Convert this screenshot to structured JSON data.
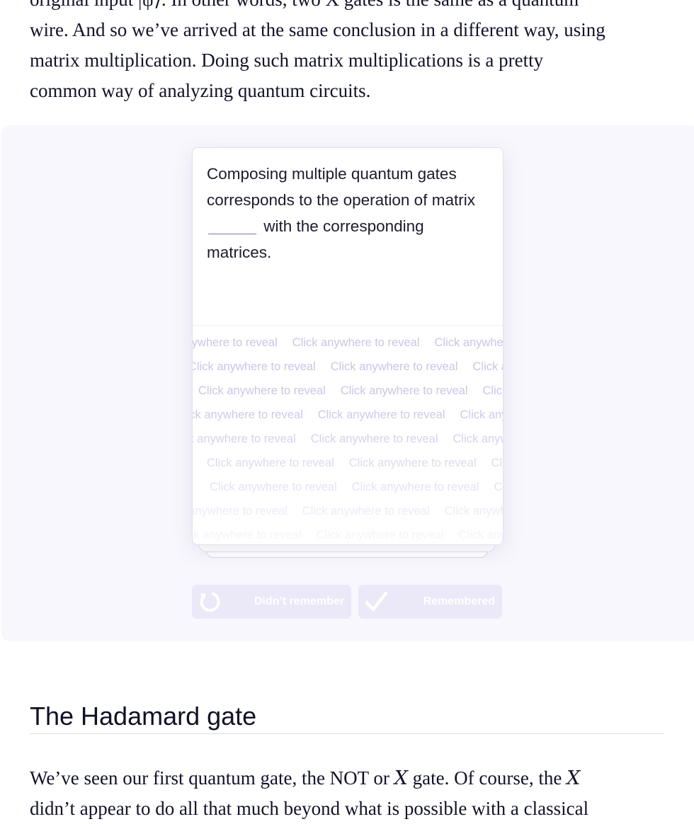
{
  "article": {
    "top_paragraph": {
      "line1_cut": "original input |ψ⟩. In other words, two X gates is the same as a quantum",
      "line2": "wire. And so we’ve arrived at the same conclusion in a different way, using",
      "line3": "matrix multiplication. Doing such matrix multiplications is a pretty",
      "line4": "common way of analyzing quantum circuits."
    },
    "section_heading": "The Hadamard gate",
    "bottom_paragraph": {
      "seg1": "We’ve seen our first quantum gate, the NOT or ",
      "math1": "X",
      "seg2": " gate. Of course, the ",
      "math2": "X",
      "line2": "didn’t appear to do all that much beyond what is possible with a classical"
    }
  },
  "flashcard": {
    "prompt_before_blank": "Composing multiple quantum gates corresponds to the operation of matrix",
    "prompt_after_blank": "with the corresponding matrices.",
    "reveal_hint": "Click anywhere to reveal",
    "forgot_label": "Didn’t remember",
    "remember_label": "Remembered",
    "forgot_icon": "retry-icon",
    "remember_icon": "checkmark-icon",
    "accent_color": "#ebe8f8"
  }
}
